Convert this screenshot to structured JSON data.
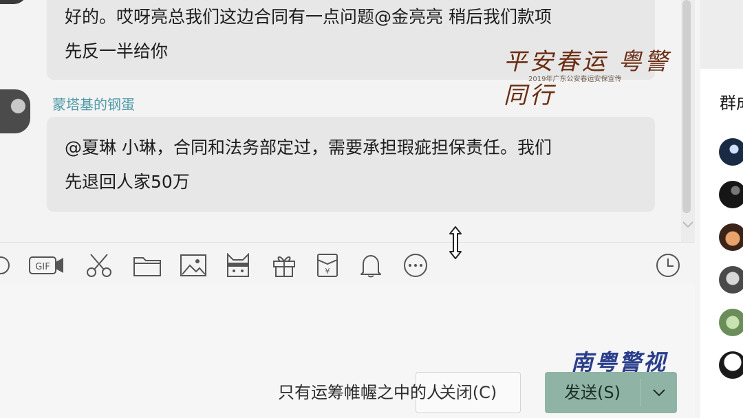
{
  "chat": {
    "messages": [
      {
        "text_line1": "好的。哎呀亮总我们这边合同有一点问题@金亮亮 稍后我们款项",
        "text_line2": "先反一半给你"
      },
      {
        "sender": "蒙塔基的钢蛋",
        "text_line1": "@夏琳 小琳，合同和法务部定过，需要承担瑕疵担保责任。我们",
        "text_line2": "先退回人家50万"
      }
    ]
  },
  "overlays": {
    "watermark_top": "平安春运 粤警同行",
    "watermark_top_sub": "2019年广东公安春运安保宣传",
    "watermark_bottom": "南粤警视",
    "subtitle": "只有运筹帷幄之中的人"
  },
  "toolbar": {
    "gif_label": "GIF",
    "icons": [
      "emoji-icon",
      "gif-icon",
      "scissors-icon",
      "folder-icon",
      "image-icon",
      "screenshot-icon",
      "gift-icon",
      "red-packet-icon",
      "bell-icon",
      "more-icon",
      "history-clock-icon"
    ]
  },
  "actions": {
    "close_label": "关闭(C)",
    "send_label": "发送(S)"
  },
  "sidebar": {
    "title": "群成员"
  },
  "colors": {
    "bubble": "#e7e7e7",
    "sender_name": "#4f9aa8",
    "send_button": "#8fb4a6"
  }
}
